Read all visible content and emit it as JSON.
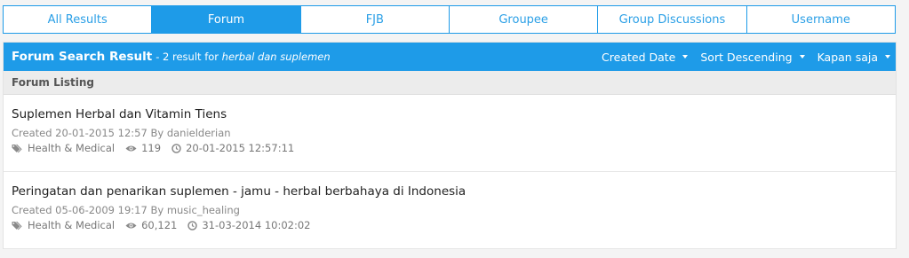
{
  "tabs": [
    {
      "label": "All Results",
      "active": false
    },
    {
      "label": "Forum",
      "active": true
    },
    {
      "label": "FJB",
      "active": false
    },
    {
      "label": "Groupee",
      "active": false
    },
    {
      "label": "Group Discussions",
      "active": false
    },
    {
      "label": "Username",
      "active": false
    }
  ],
  "header": {
    "title": "Forum Search Result",
    "subtitle_prefix": "- 2 result for",
    "query": "herbal dan suplemen",
    "dropdowns": [
      "Created Date",
      "Sort Descending",
      "Kapan saja"
    ]
  },
  "listing_label": "Forum Listing",
  "results": [
    {
      "title": "Suplemen Herbal dan Vitamin Tiens",
      "created": "Created 20-01-2015 12:57 By",
      "author": "danielderian",
      "category": "Health & Medical",
      "views": "119",
      "last_post": "20-01-2015 12:57:11"
    },
    {
      "title": "Peringatan dan penarikan suplemen - jamu - herbal berbahaya di Indonesia",
      "created": "Created 05-06-2009 19:17 By",
      "author": "music_healing",
      "category": "Health & Medical",
      "views": "60,121",
      "last_post": "31-03-2014 10:02:02"
    }
  ],
  "colors": {
    "accent": "#1e9be8",
    "header_text": "#ffffff",
    "meta_text": "#888888"
  },
  "icons": {
    "tag": "tag-icon",
    "views": "eye-icon",
    "time": "clock-icon",
    "caret": "caret-down-icon"
  }
}
